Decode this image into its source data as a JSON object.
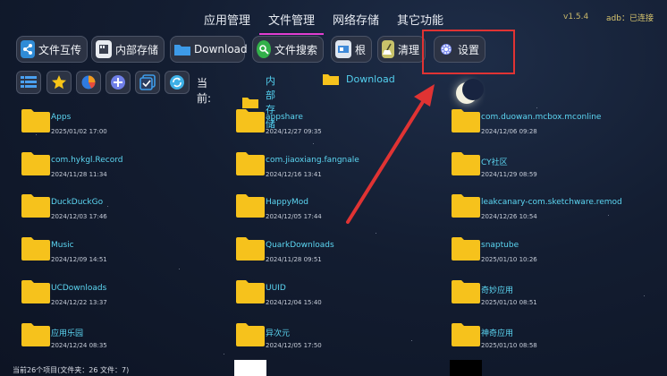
{
  "top_tabs": [
    {
      "label": "应用管理",
      "active": false
    },
    {
      "label": "文件管理",
      "active": true
    },
    {
      "label": "网络存储",
      "active": false
    },
    {
      "label": "其它功能",
      "active": false
    }
  ],
  "version": "v1.5.4",
  "adb_status": "adb：已连接",
  "toolbar": {
    "file_share": "文件互传",
    "internal_storage": "内部存储",
    "download": "Download",
    "file_search": "文件搜索",
    "root": "根",
    "clean": "清理",
    "settings": "设置"
  },
  "breadcrumb": {
    "current_label": "当前:",
    "items": [
      "内部存储",
      "Download"
    ]
  },
  "colors": {
    "accent_tab": "#e23ed0",
    "link_text": "#5cd6f2",
    "folder": "#f6c21c",
    "annotation": "#e03333"
  },
  "files": [
    {
      "name": "Apps",
      "date": "2025/01/02 17:00"
    },
    {
      "name": "appshare",
      "date": "2024/12/27 09:35"
    },
    {
      "name": "com.duowan.mcbox.mconline",
      "date": "2024/12/06 09:28"
    },
    {
      "name": "com.hykgl.Record",
      "date": "2024/11/28 11:34"
    },
    {
      "name": "com.jiaoxiang.fangnale",
      "date": "2024/12/16 13:41"
    },
    {
      "name": "CY社区",
      "date": "2024/11/29 08:59"
    },
    {
      "name": "DuckDuckGo",
      "date": "2024/12/03 17:46"
    },
    {
      "name": "HappyMod",
      "date": "2024/12/05 17:44"
    },
    {
      "name": "leakcanary-com.sketchware.remod",
      "date": "2024/12/26 10:54"
    },
    {
      "name": "Music",
      "date": "2024/12/09 14:51"
    },
    {
      "name": "QuarkDownloads",
      "date": "2024/11/28 09:51"
    },
    {
      "name": "snaptube",
      "date": "2025/01/10 10:26"
    },
    {
      "name": "UCDownloads",
      "date": "2024/12/22 13:37"
    },
    {
      "name": "UUID",
      "date": "2024/12/04 15:40"
    },
    {
      "name": "奇妙应用",
      "date": "2025/01/10 08:51"
    },
    {
      "name": "应用乐园",
      "date": "2024/12/24 08:35"
    },
    {
      "name": "异次元",
      "date": "2024/12/05 17:50"
    },
    {
      "name": "神奇应用",
      "date": "2025/01/10 08:58"
    }
  ],
  "status": "当前26个项目(文件夹：26  文件：7)"
}
